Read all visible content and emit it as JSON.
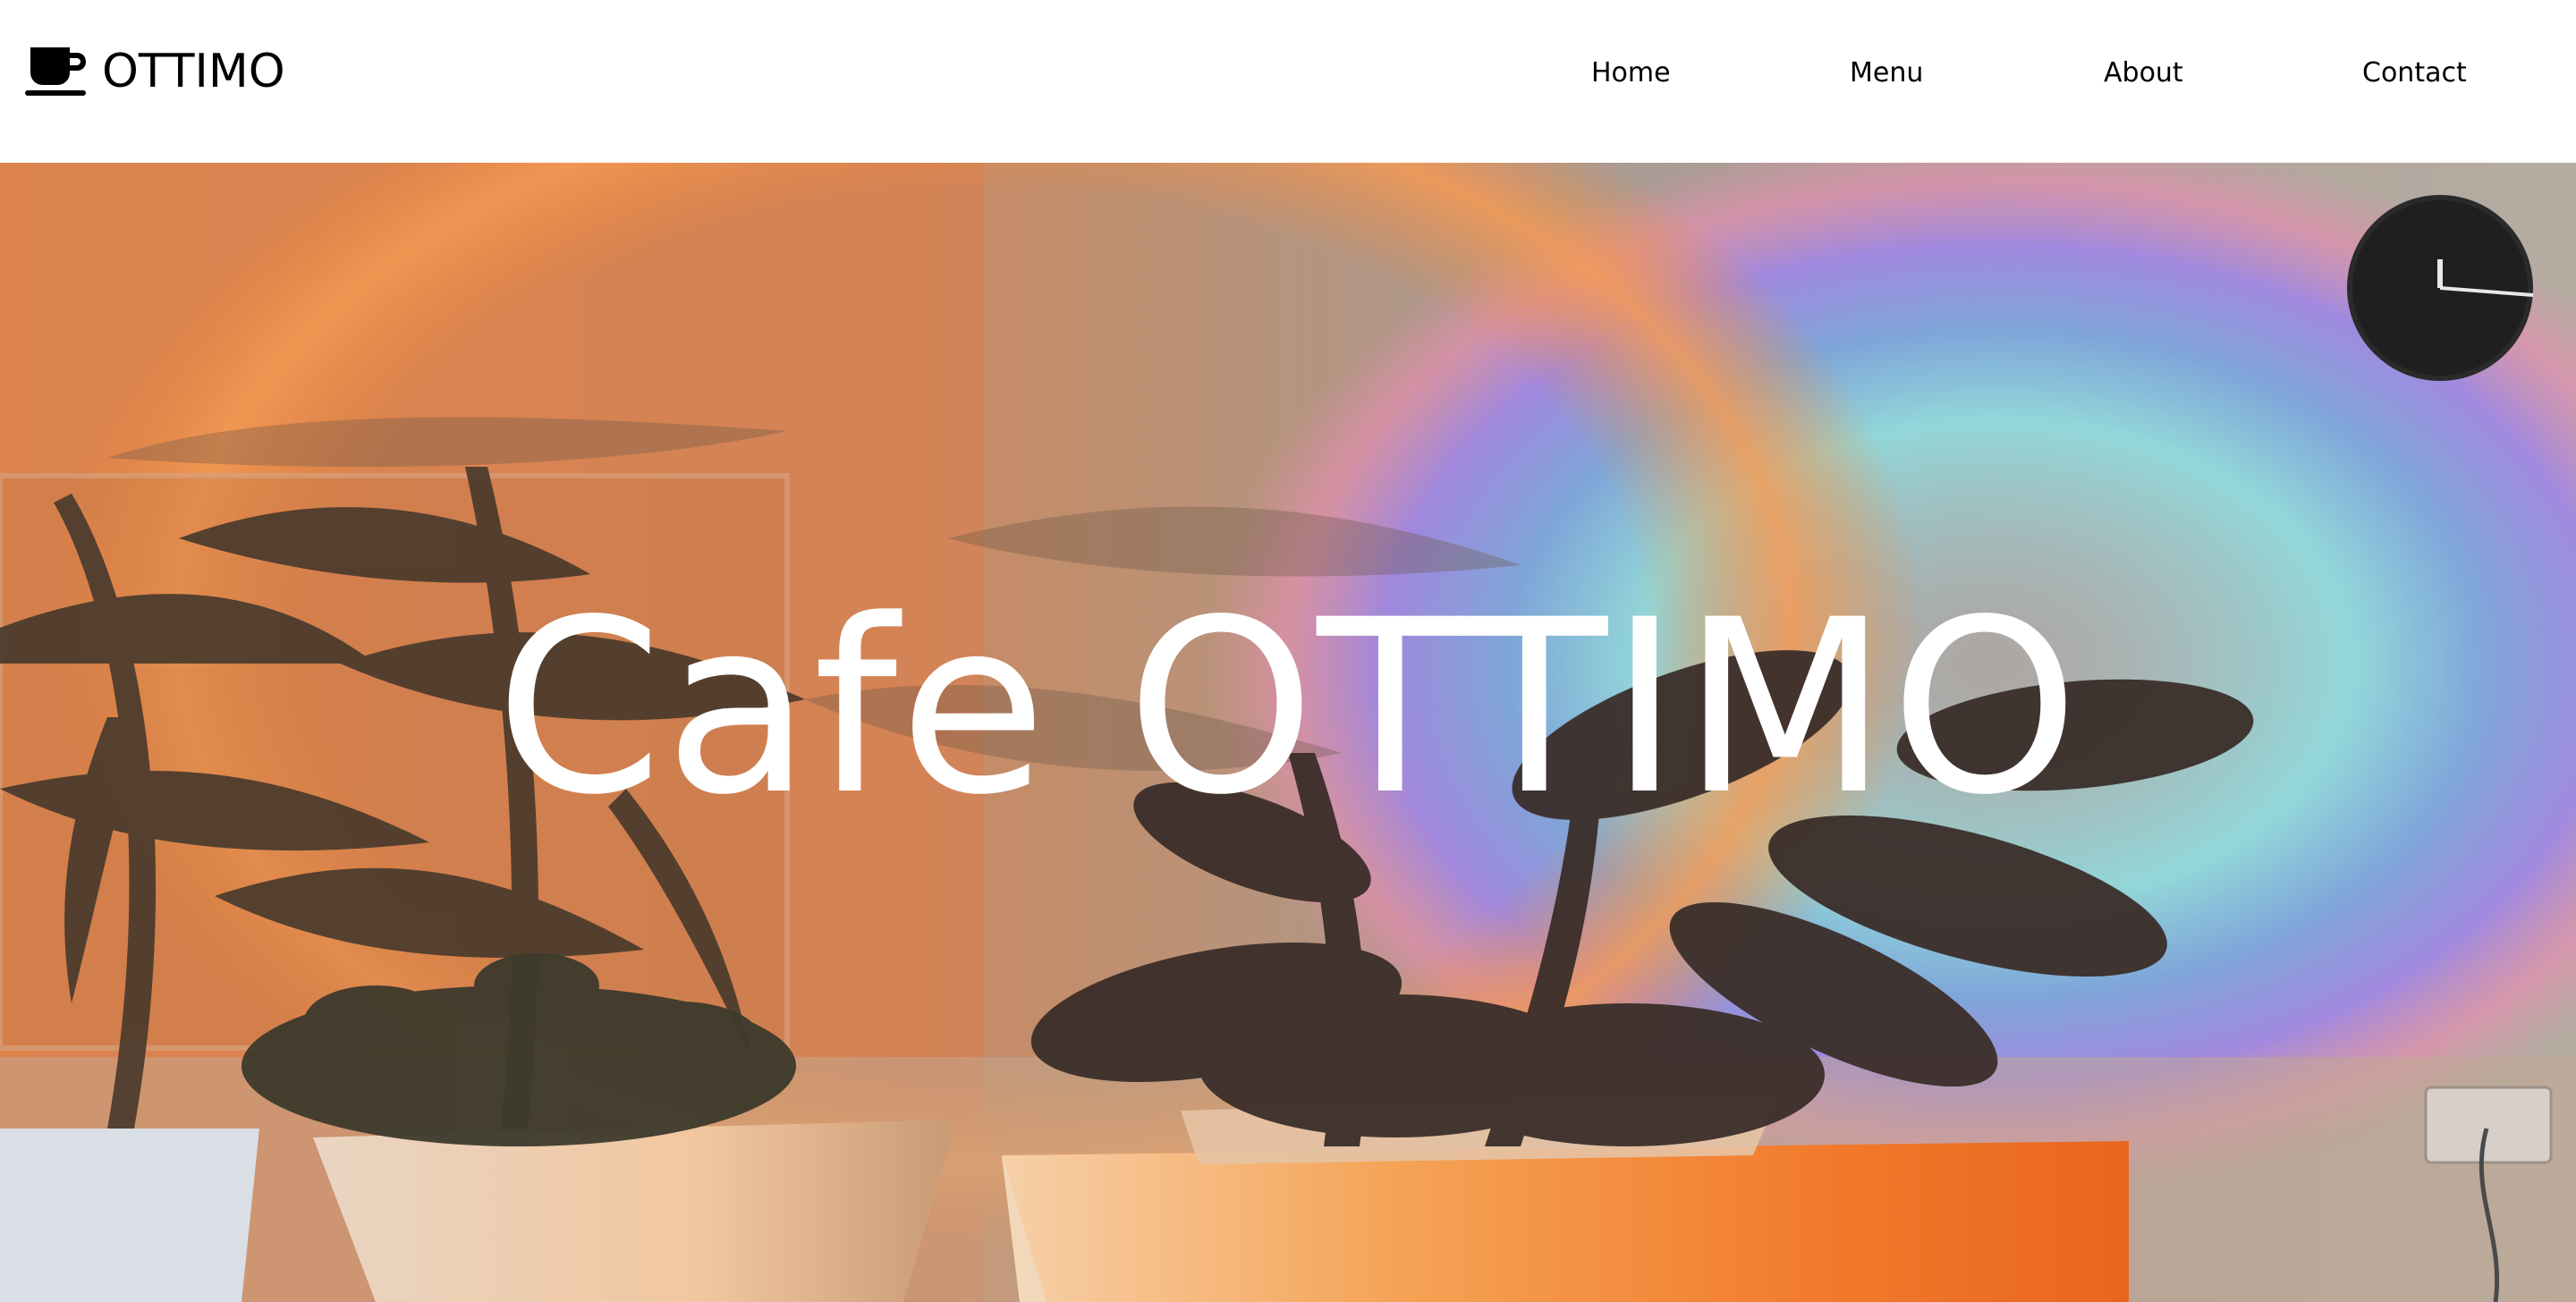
{
  "brand": {
    "name": "OTTIMO",
    "logo_icon": "coffee-cup-icon"
  },
  "nav": {
    "items": [
      {
        "label": "Home"
      },
      {
        "label": "Menu"
      },
      {
        "label": "About"
      },
      {
        "label": "Contact"
      }
    ]
  },
  "hero": {
    "title": "Cafe OTTIMO",
    "image": "sunset-lamp-plants-photo"
  },
  "colors": {
    "nav_bg": "#ffffff",
    "nav_text": "#000000",
    "hero_text": "#ffffff",
    "orange_glow": "#f08a3c",
    "violet_glow": "#9f86e6",
    "cyan_glow": "#8fdde0"
  }
}
